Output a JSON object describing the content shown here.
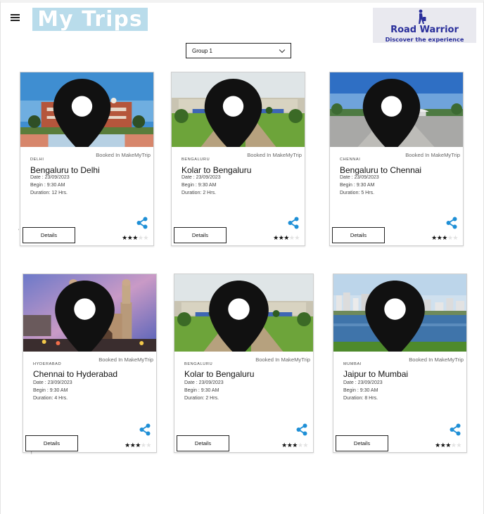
{
  "header": {
    "app_logo_text": "My Trips",
    "brand_logo": {
      "name": "Road Warrior",
      "tagline": "Discover the experience"
    }
  },
  "group_select": {
    "selected": "Group 1"
  },
  "colors": {
    "accent_blue": "#1e8fd6",
    "brand_navy": "#2a2f9b",
    "logo_sky": "#b9dceb"
  },
  "trips": [
    {
      "city": "DELHI",
      "title": "Bengaluru to Delhi",
      "booked": "Booked In MakeMyTrip",
      "date": "Date : 23/09/2023",
      "begin": "Begin : 9:30 AM",
      "duration": "Duration: 12 Hrs.",
      "details_label": "Details",
      "rating": 3,
      "rating_max": 5,
      "image": "tomb-monument",
      "icon_location": "location-pin-icon",
      "icon_share": "share-icon"
    },
    {
      "city": "BENGALURU",
      "title": "Kolar to Bengaluru",
      "booked": "Booked In MakeMyTrip",
      "date": "Date : 23/09/2023",
      "begin": "Begin : 9:30 AM",
      "duration": "Duration: 2 Hrs.",
      "details_label": "Details",
      "rating": 3,
      "rating_max": 5,
      "image": "government-building",
      "icon_location": "location-pin-icon",
      "icon_share": "share-icon"
    },
    {
      "city": "CHENNAI",
      "title": "Bengaluru to Chennai",
      "booked": "Booked In MakeMyTrip",
      "date": "Date : 23/09/2023",
      "begin": "Begin : 9:30 AM",
      "duration": "Duration: 5 Hrs.",
      "details_label": "Details",
      "rating": 3,
      "rating_max": 5,
      "image": "memorial-plaza",
      "icon_location": "location-pin-icon",
      "icon_share": "share-icon"
    },
    {
      "city": "HYDERABAD",
      "title": "Chennai to Hyderabad",
      "booked": "Booked In MakeMyTrip",
      "date": "Date : 23/09/2023",
      "begin": "Begin : 9:30 AM",
      "duration": "Duration: 4 Hrs.",
      "details_label": "Details",
      "rating": 3,
      "rating_max": 5,
      "image": "minaret-monument",
      "icon_location": "location-pin-icon",
      "icon_share": "share-icon"
    },
    {
      "city": "BENGALURU",
      "title": "Kolar to Bengaluru",
      "booked": "Booked In MakeMyTrip",
      "date": "Date : 23/09/2023",
      "begin": "Begin : 9:30 AM",
      "duration": "Duration: 2 Hrs.",
      "details_label": "Details",
      "rating": 3,
      "rating_max": 5,
      "image": "government-building",
      "icon_location": "location-pin-icon",
      "icon_share": "share-icon"
    },
    {
      "city": "MUMBAI",
      "title": "Jaipur to Mumbai",
      "booked": "Booked In MakeMyTrip",
      "date": "Date : 23/09/2023",
      "begin": "Begin : 9:30 AM",
      "duration": "Duration: 8 Hrs.",
      "details_label": "Details",
      "rating": 3,
      "rating_max": 5,
      "image": "city-skyline-lake",
      "icon_location": "location-pin-icon",
      "icon_share": "share-icon"
    }
  ]
}
